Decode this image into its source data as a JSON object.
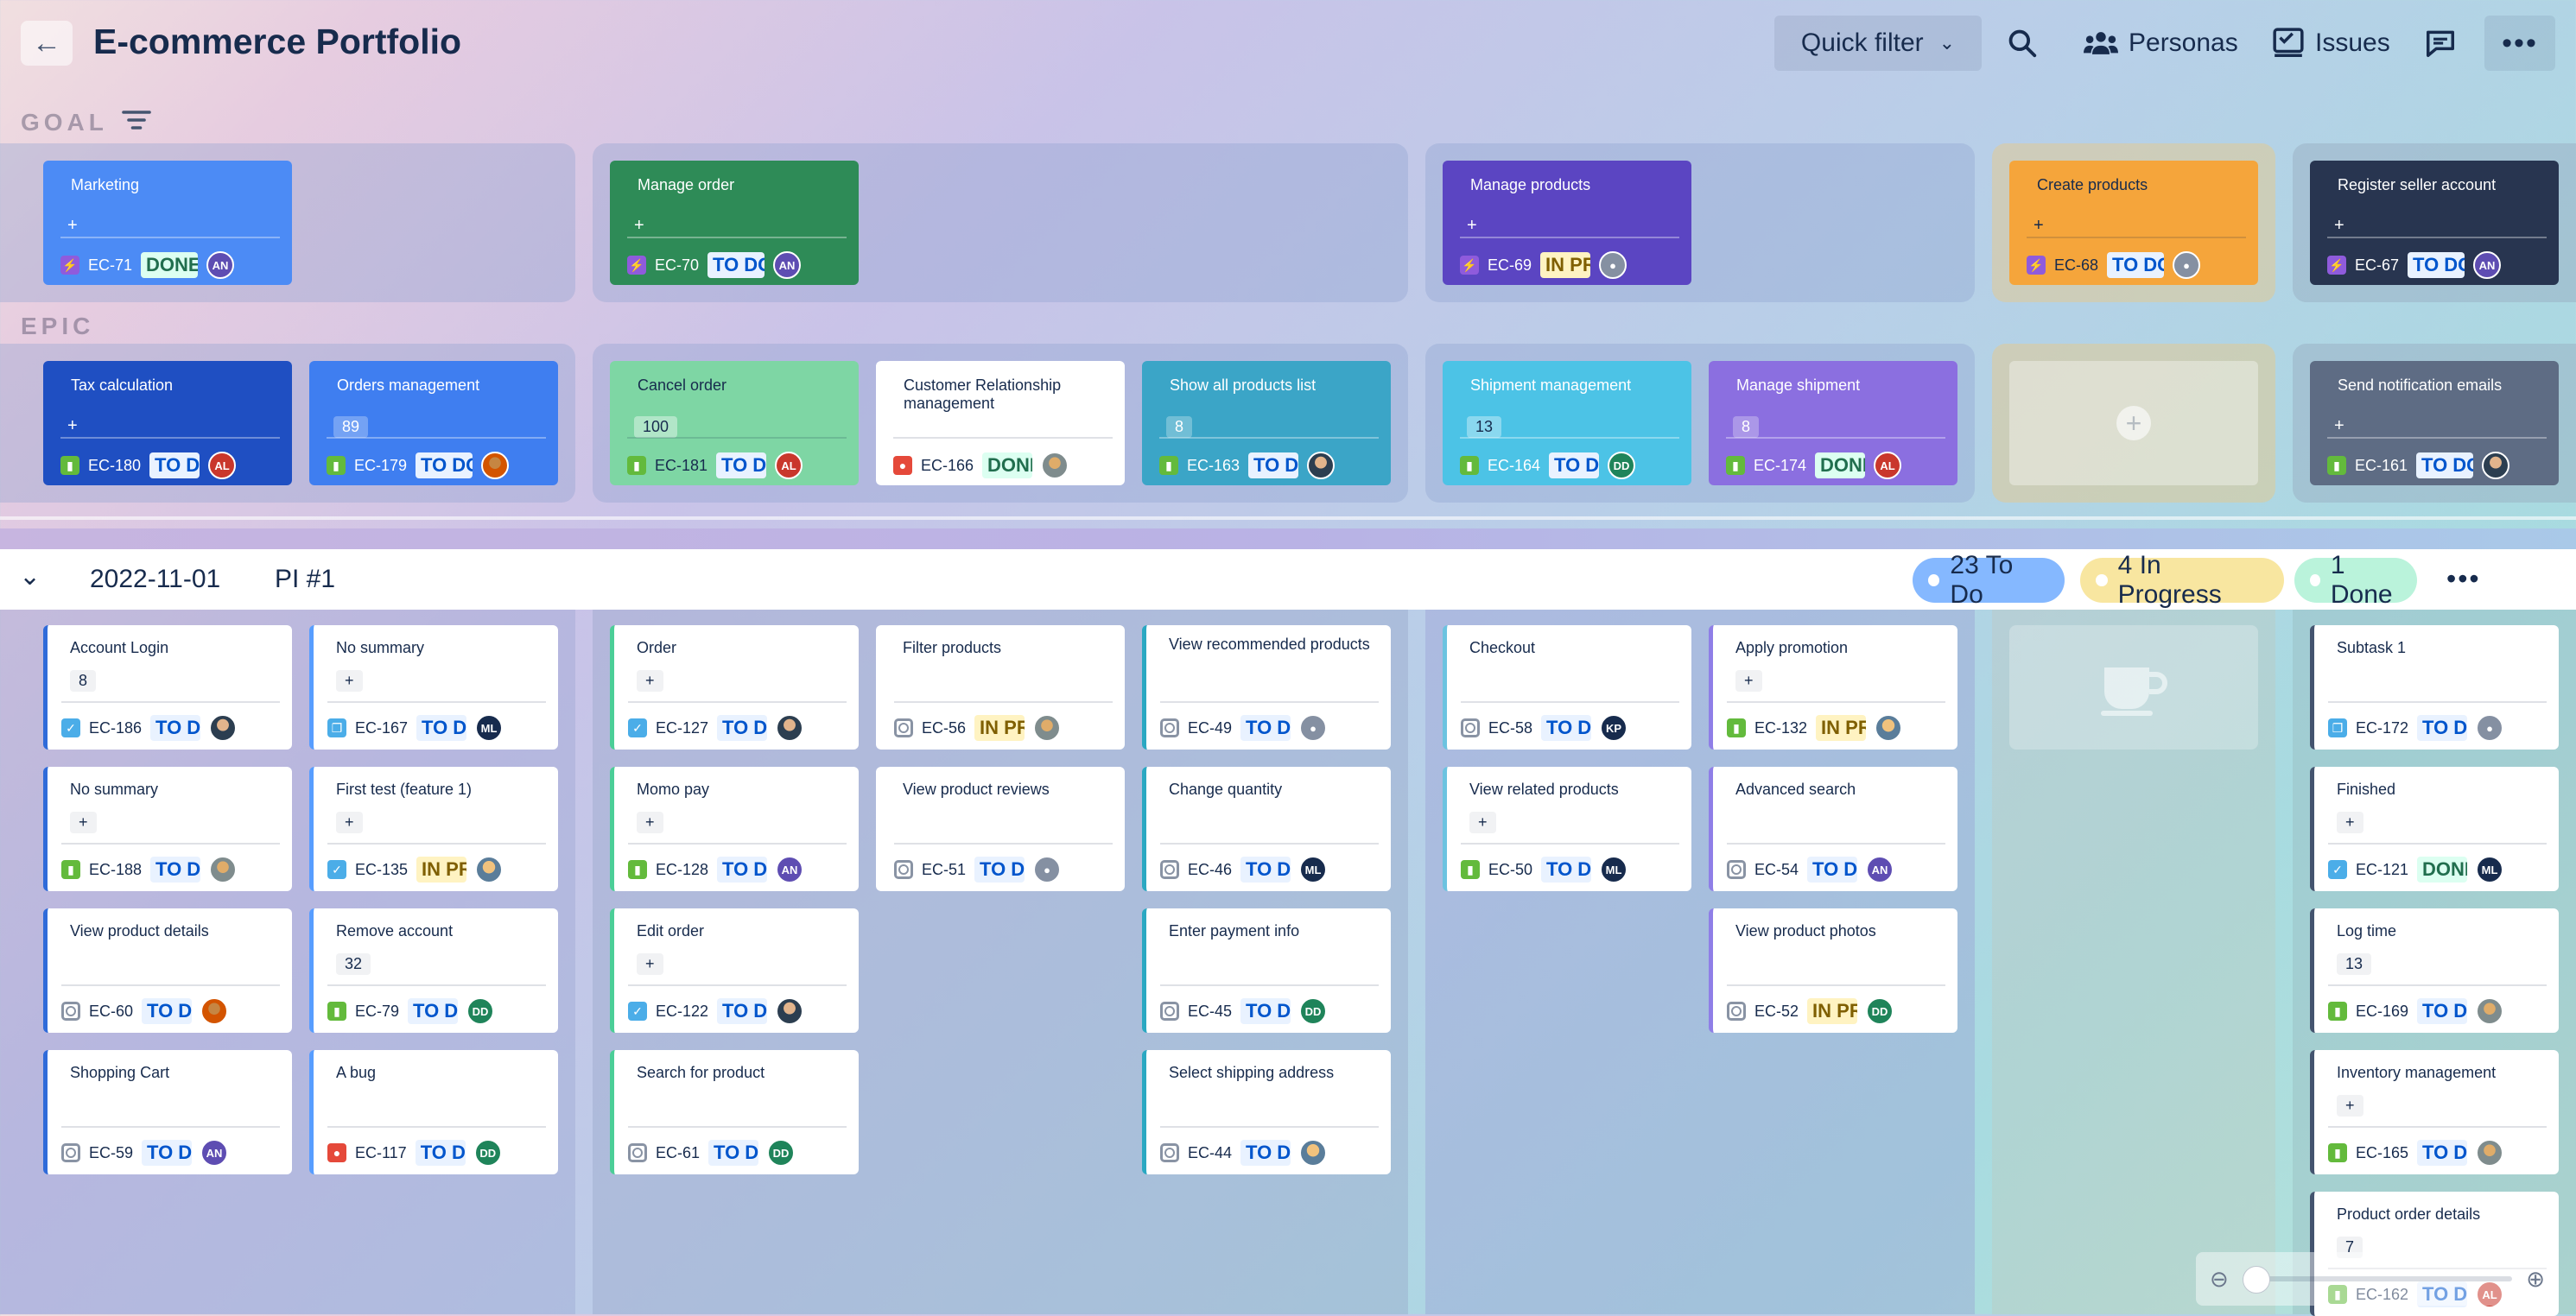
{
  "header": {
    "back_icon": "arrow-left-icon",
    "title": "E-commerce Portfolio",
    "quick_filter": "Quick filter",
    "personas": "Personas",
    "issues": "Issues"
  },
  "lanes": {
    "goal": "GOAL",
    "epic": "EPIC"
  },
  "goals": [
    {
      "title": "Marketing",
      "key": "EC-71",
      "status": "DONE",
      "avatar": "AN",
      "color": "#4c8bf5"
    },
    {
      "title": "Manage order",
      "key": "EC-70",
      "status": "TO DO",
      "avatar": "AN",
      "color": "#2e8b57"
    },
    {
      "title": "Manage products",
      "key": "EC-69",
      "status": "IN PROGRESS",
      "avatar": "",
      "color": "#5b45c2"
    },
    {
      "title": "Create products",
      "key": "EC-68",
      "status": "TO DO",
      "avatar": "",
      "color": "#f5a53b"
    },
    {
      "title": "Register seller account",
      "key": "EC-67",
      "status": "TO DO",
      "avatar": "AN",
      "color": "#283550"
    }
  ],
  "epics": [
    {
      "title": "Tax calculation",
      "meta": "+",
      "key": "EC-180",
      "status": "TO DO",
      "avatar": "AL"
    },
    {
      "title": "Orders management",
      "meta": "89",
      "key": "EC-179",
      "status": "TO DO",
      "avatar": ""
    },
    {
      "title": "Cancel order",
      "meta": "100",
      "key": "EC-181",
      "status": "TO DO",
      "avatar": "AL"
    },
    {
      "title": "Customer Relationship management",
      "meta": "",
      "key": "EC-166",
      "status": "DONE",
      "avatar": ""
    },
    {
      "title": "Show all products list",
      "meta": "8",
      "key": "EC-163",
      "status": "TO DO",
      "avatar": ""
    },
    {
      "title": "Shipment management",
      "meta": "13",
      "key": "EC-164",
      "status": "TO DO",
      "avatar": "DD"
    },
    {
      "title": "Manage shipment",
      "meta": "8",
      "key": "EC-174",
      "status": "DONE",
      "avatar": "AL"
    },
    {
      "title": "Send notification emails",
      "meta": "+",
      "key": "EC-161",
      "status": "TO DO",
      "avatar": ""
    }
  ],
  "pi": {
    "date": "2022-11-01",
    "name": "PI #1",
    "todo": "23 To Do",
    "progress": "4 In Progress",
    "done": "1 Done"
  },
  "cards": [
    {
      "title": "Account Login",
      "meta": "8",
      "key": "EC-186",
      "status": "TO DO",
      "avatar": ""
    },
    {
      "title": "No summary",
      "meta": "+",
      "key": "EC-188",
      "status": "TO DO",
      "avatar": ""
    },
    {
      "title": "View product details",
      "meta": "",
      "key": "EC-60",
      "status": "TO DO",
      "avatar": ""
    },
    {
      "title": "Shopping Cart",
      "meta": "",
      "key": "EC-59",
      "status": "TO DO",
      "avatar": "AN"
    },
    {
      "title": "No summary",
      "meta": "+",
      "key": "EC-167",
      "status": "TO DO",
      "avatar": "ML"
    },
    {
      "title": "First test (feature 1)",
      "meta": "+",
      "key": "EC-135",
      "status": "IN PROGRESS",
      "avatar": ""
    },
    {
      "title": "Remove account",
      "meta": "32",
      "key": "EC-79",
      "status": "TO DO",
      "avatar": "DD"
    },
    {
      "title": "A bug",
      "meta": "",
      "key": "EC-117",
      "status": "TO DO",
      "avatar": "DD"
    },
    {
      "title": "Order",
      "meta": "+",
      "key": "EC-127",
      "status": "TO DO",
      "avatar": ""
    },
    {
      "title": "Momo pay",
      "meta": "+",
      "key": "EC-128",
      "status": "TO DO",
      "avatar": "AN"
    },
    {
      "title": "Edit order",
      "meta": "+",
      "key": "EC-122",
      "status": "TO DO",
      "avatar": ""
    },
    {
      "title": "Search for product",
      "meta": "",
      "key": "EC-61",
      "status": "TO DO",
      "avatar": "DD"
    },
    {
      "title": "Filter products",
      "meta": "",
      "key": "EC-56",
      "status": "IN PROGRESS",
      "avatar": ""
    },
    {
      "title": "View product reviews",
      "meta": "",
      "key": "EC-51",
      "status": "TO DO",
      "avatar": ""
    },
    {
      "title": "View recommended products",
      "meta": "",
      "key": "EC-49",
      "status": "TO DO",
      "avatar": ""
    },
    {
      "title": "Change quantity",
      "meta": "",
      "key": "EC-46",
      "status": "TO DO",
      "avatar": "ML"
    },
    {
      "title": "Enter payment info",
      "meta": "",
      "key": "EC-45",
      "status": "TO DO",
      "avatar": "DD"
    },
    {
      "title": "Select shipping address",
      "meta": "",
      "key": "EC-44",
      "status": "TO DO",
      "avatar": ""
    },
    {
      "title": "Checkout",
      "meta": "",
      "key": "EC-58",
      "status": "TO DO",
      "avatar": "KP"
    },
    {
      "title": "View related products",
      "meta": "+",
      "key": "EC-50",
      "status": "TO DO",
      "avatar": "ML"
    },
    {
      "title": "Apply promotion",
      "meta": "+",
      "key": "EC-132",
      "status": "IN PROGRESS",
      "avatar": ""
    },
    {
      "title": "Advanced search",
      "meta": "",
      "key": "EC-54",
      "status": "TO DO",
      "avatar": "AN"
    },
    {
      "title": "View product photos",
      "meta": "",
      "key": "EC-52",
      "status": "IN PROGRESS",
      "avatar": "DD"
    },
    {
      "title": "Subtask 1",
      "meta": "",
      "key": "EC-172",
      "status": "TO DO",
      "avatar": ""
    },
    {
      "title": "Finished",
      "meta": "+",
      "key": "EC-121",
      "status": "DONE",
      "avatar": "ML"
    },
    {
      "title": "Log time",
      "meta": "13",
      "key": "EC-169",
      "status": "TO DO",
      "avatar": ""
    },
    {
      "title": "Inventory management",
      "meta": "+",
      "key": "EC-165",
      "status": "TO DO",
      "avatar": ""
    },
    {
      "title": "Product order details",
      "meta": "7",
      "key": "EC-162",
      "status": "TO DO",
      "avatar": "AL"
    }
  ]
}
